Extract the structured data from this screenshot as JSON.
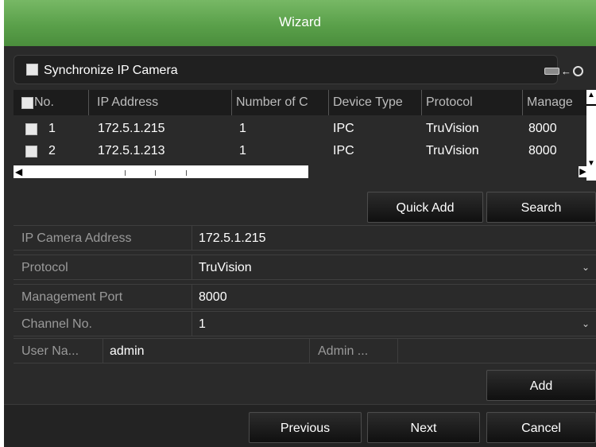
{
  "window": {
    "title": "Wizard"
  },
  "sync": {
    "label": "Synchronize IP Camera"
  },
  "table": {
    "columns": [
      "No.",
      "IP Address",
      "Number of C",
      "Device Type",
      "Protocol",
      "Manage"
    ],
    "rows": [
      {
        "no": "1",
        "ip": "172.5.1.215",
        "count": "1",
        "type": "IPC",
        "protocol": "TruVision",
        "port": "8000"
      },
      {
        "no": "2",
        "ip": "172.5.1.213",
        "count": "1",
        "type": "IPC",
        "protocol": "TruVision",
        "port": "8000"
      }
    ]
  },
  "actions": {
    "quick_add": "Quick Add",
    "search": "Search",
    "add": "Add"
  },
  "form": {
    "ip_label": "IP Camera Address",
    "ip_value": "172.5.1.215",
    "protocol_label": "Protocol",
    "protocol_value": "TruVision",
    "port_label": "Management Port",
    "port_value": "8000",
    "channel_label": "Channel No.",
    "channel_value": "1",
    "user_label": "User Na...",
    "user_value": "admin",
    "password_label": "Admin ...",
    "password_value": ""
  },
  "footer": {
    "previous": "Previous",
    "next": "Next",
    "cancel": "Cancel"
  }
}
